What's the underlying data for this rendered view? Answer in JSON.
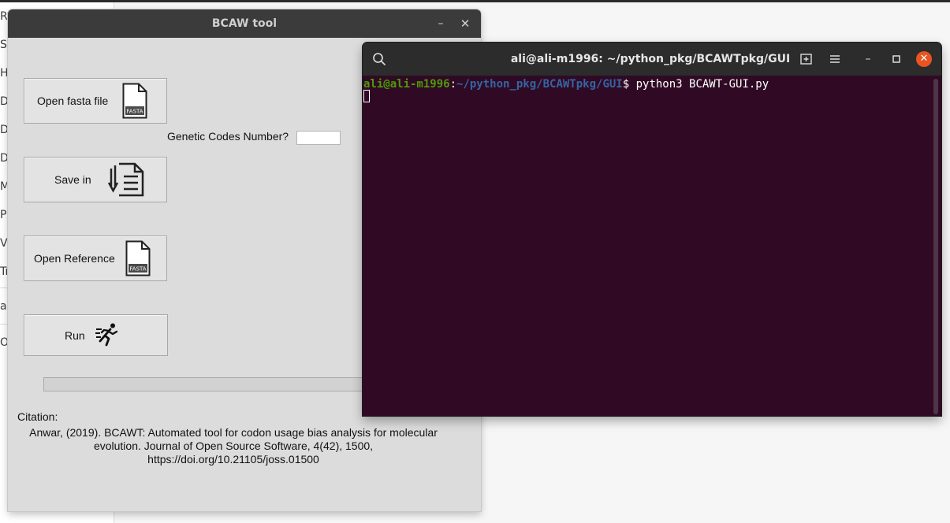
{
  "background_app": {
    "sidebar_items": [
      "Re",
      "St",
      "Ho",
      "De",
      "Do",
      "Do",
      "Mu",
      "Pi",
      "Vi",
      "Tr",
      "al",
      "O"
    ]
  },
  "bcaw_window": {
    "title": "BCAW tool",
    "minimize_symbol": "–",
    "close_symbol": "✕",
    "open_fasta_label": "Open fasta file",
    "fasta_icon_text": "FASTA",
    "genetic_codes_label": "Genetic Codes Number?",
    "genetic_codes_value": "",
    "save_in_label": "Save in",
    "open_reference_label": "Open Reference",
    "run_label": "Run",
    "progress": 0,
    "citation_label": "Citation:",
    "citation_text": "Anwar, (2019). BCAWT: Automated tool for codon usage bias analysis for molecular\nevolution. Journal of Open Source Software, 4(42), 1500,\nhttps://doi.org/10.21105/joss.01500"
  },
  "terminal": {
    "title": "ali@ali-m1996: ~/python_pkg/BCAWTpkg/GUI",
    "prompt_user": "ali@ali-m1996",
    "prompt_colon": ":",
    "prompt_path": "~/python_pkg/BCAWTpkg/GUI",
    "prompt_dollar": "$ ",
    "command": "python3 BCAWT-GUI.py",
    "close_symbol": "✕",
    "minimize_symbol": "–",
    "maximize_symbol": "▢",
    "menu_symbol": "☰",
    "new_tab_symbol": "⊞",
    "search_symbol": "⌕",
    "colors": {
      "background": "#300a24",
      "user": "#4e9a06",
      "path": "#3465a4",
      "close": "#e95420"
    }
  }
}
